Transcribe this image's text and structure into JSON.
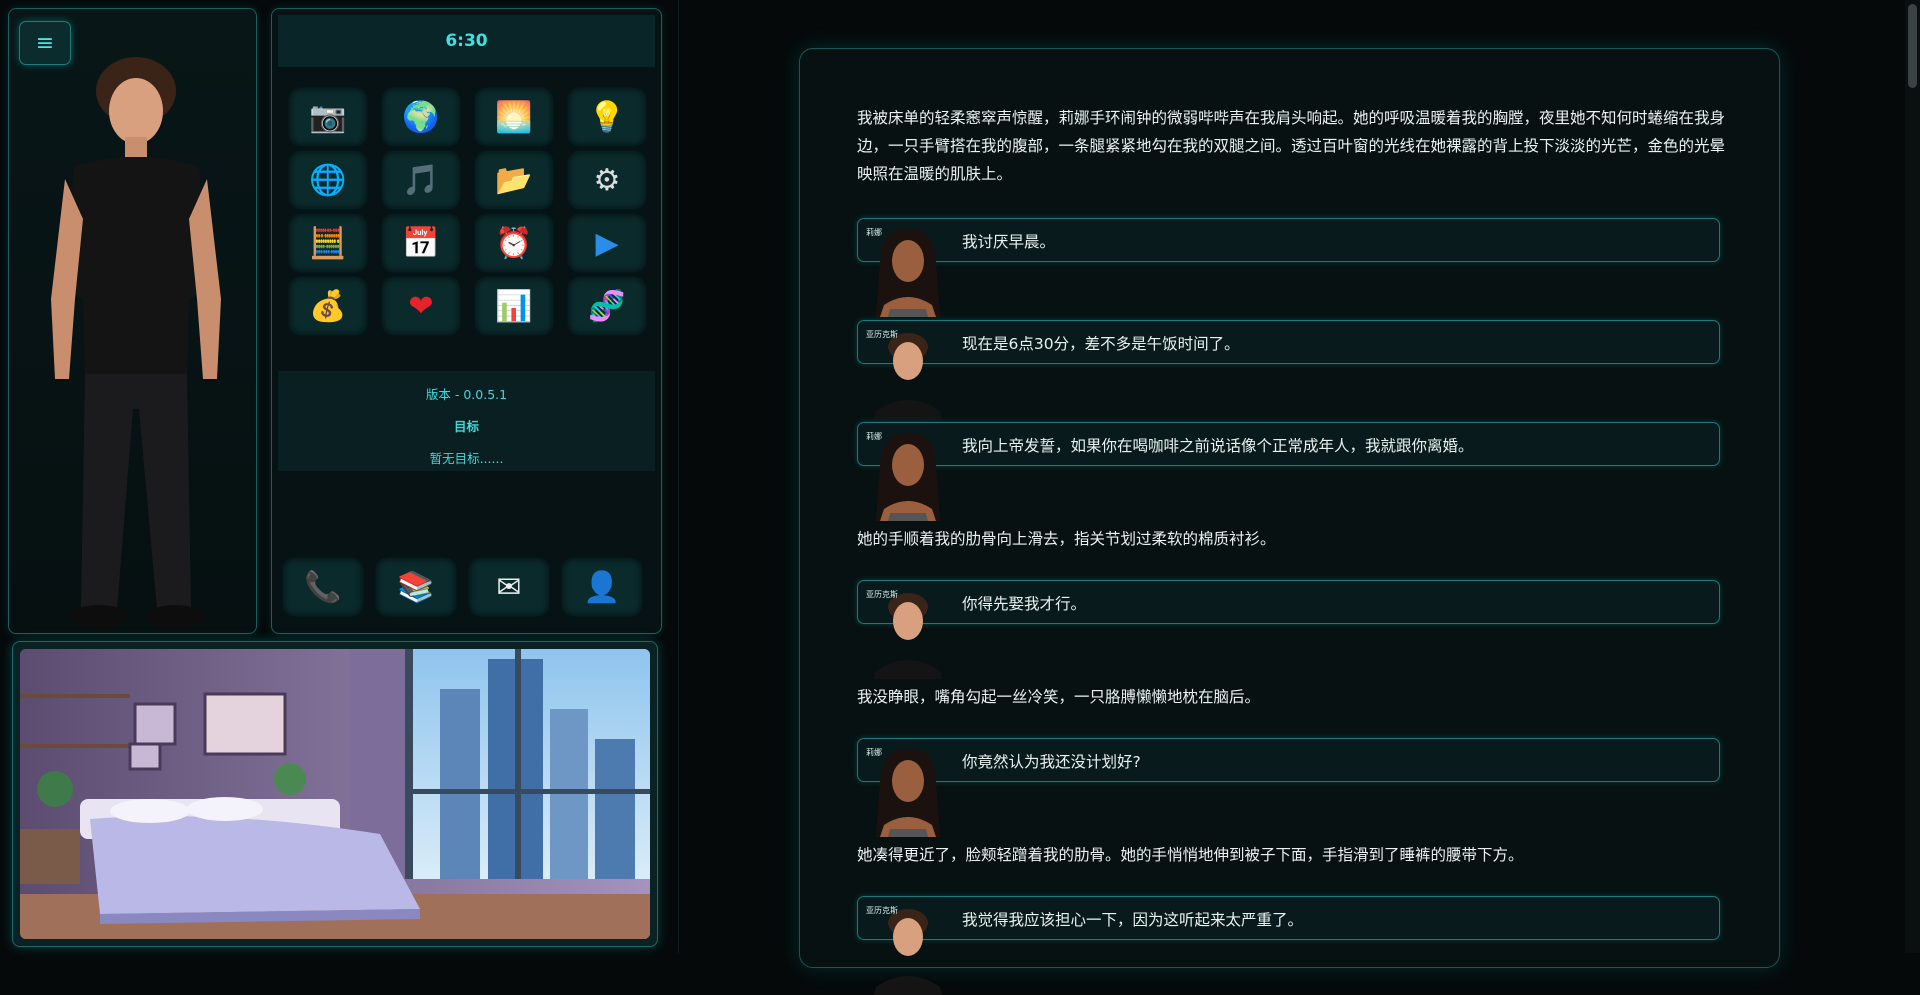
{
  "menu_button": {
    "label": "≡"
  },
  "phone": {
    "time": "6:30",
    "apps": [
      {
        "name": "camera-icon",
        "glyph": "📷"
      },
      {
        "name": "globe-icon",
        "glyph": "🌍"
      },
      {
        "name": "sunrise-icon",
        "glyph": "🌅"
      },
      {
        "name": "lightbulb-icon",
        "glyph": "💡"
      },
      {
        "name": "web-icon",
        "glyph": "🌐"
      },
      {
        "name": "music-icon",
        "glyph": "🎵"
      },
      {
        "name": "folder-icon",
        "glyph": "📂"
      },
      {
        "name": "gear-icon",
        "glyph": "⚙"
      },
      {
        "name": "calculator-icon",
        "glyph": "🧮"
      },
      {
        "name": "calendar-icon",
        "glyph": "📅"
      },
      {
        "name": "alarm-clock-icon",
        "glyph": "⏰"
      },
      {
        "name": "play-icon",
        "glyph": "▶"
      },
      {
        "name": "money-bag-icon",
        "glyph": "💰"
      },
      {
        "name": "heart-icon",
        "glyph": "❤"
      },
      {
        "name": "bar-chart-icon",
        "glyph": "📊"
      },
      {
        "name": "dna-icon",
        "glyph": "🧬"
      }
    ],
    "info": {
      "version": "版本 - 0.0.5.1",
      "goal_title": "目标",
      "goal_text": "暂无目标......"
    },
    "dock": [
      {
        "name": "phone-icon",
        "glyph": "📞"
      },
      {
        "name": "books-icon",
        "glyph": "📚"
      },
      {
        "name": "envelope-icon",
        "glyph": "✉"
      },
      {
        "name": "contact-icon",
        "glyph": "👤"
      }
    ]
  },
  "story": {
    "narration_1": "我被床单的轻柔窸窣声惊醒，莉娜手环闹钟的微弱哔哔声在我肩头响起。她的呼吸温暖着我的胸膛，夜里她不知何时蜷缩在我身边，一只手臂搭在我的腹部，一条腿紧紧地勾在我的双腿之间。透过百叶窗的光线在她裸露的背上投下淡淡的光芒，金色的光晕映照在温暖的肌肤上。",
    "lines": [
      {
        "speaker": "莉娜",
        "text": "我讨厌早晨。"
      },
      {
        "speaker": "亚历克斯",
        "text": "现在是6点30分，差不多是午饭时间了。"
      },
      {
        "speaker": "莉娜",
        "text": "我向上帝发誓，如果你在喝咖啡之前说话像个正常成年人，我就跟你离婚。"
      },
      {
        "speaker": "亚历克斯",
        "text": "你得先娶我才行。"
      },
      {
        "speaker": "莉娜",
        "text": "你竟然认为我还没计划好?"
      },
      {
        "speaker": "亚历克斯",
        "text": "我觉得我应该担心一下，因为这听起来太严重了。"
      }
    ],
    "narration_2": "她的手顺着我的肋骨向上滑去，指关节划过柔软的棉质衬衫。",
    "narration_3": "我没睁眼，嘴角勾起一丝冷笑，一只胳膊懒懒地枕在脑后。",
    "narration_4": "她凑得更近了，脸颊轻蹭着我的肋骨。她的手悄悄地伸到被子下面，手指滑到了睡裤的腰带下方。"
  }
}
